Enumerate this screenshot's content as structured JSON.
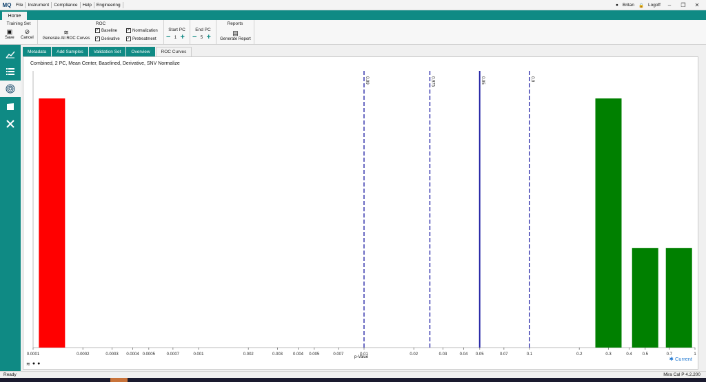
{
  "app": {
    "logo": "MQ",
    "menu": [
      "File",
      "Instrument",
      "Compliance",
      "Help",
      "Engineering"
    ],
    "user": "Britan",
    "logoff": "Logoff"
  },
  "home_tab": "Home",
  "ribbon": {
    "training_set": {
      "title": "Training Set",
      "save": "Save",
      "cancel": "Cancel"
    },
    "roc": {
      "title": "ROC",
      "generate_all": "Generate All ROC Curves",
      "baseline": "Baseline",
      "derivative": "Derivative",
      "normalization": "Normalization",
      "pretreatment": "Pretreatment"
    },
    "start_pc": {
      "label": "Start PC",
      "value": "1"
    },
    "end_pc": {
      "label": "End PC",
      "value": "5"
    },
    "reports": {
      "title": "Reports",
      "generate_report": "Generate Report"
    }
  },
  "sidebar": [
    "chart-line-icon",
    "list-icon",
    "fingerprint-icon",
    "book-icon",
    "tools-icon"
  ],
  "subtabs": [
    "Metadata",
    "Add Samples",
    "Validation Set",
    "Overview",
    "ROC Curves"
  ],
  "chart_data": {
    "type": "bar",
    "title": "Combined, 2 PC, Mean Center, Baselined, Derivative, SNV Normalize",
    "xlabel": "p-Value",
    "xscale": "log",
    "xlim": [
      0.0001,
      1
    ],
    "tick_labels": [
      "0.0001",
      "0.0002",
      "0.0003",
      "0.0004",
      "0.0005",
      "0.0007",
      "0.001",
      "0.002",
      "0.003",
      "0.004",
      "0.005",
      "0.007",
      "0.01",
      "0.02",
      "0.03",
      "0.04",
      "0.05",
      "0.07",
      "0.1",
      "0.2",
      "0.3",
      "0.4",
      "0.5",
      "0.7",
      "1"
    ],
    "tick_values": [
      0.0001,
      0.0002,
      0.0003,
      0.0004,
      0.0005,
      0.0007,
      0.001,
      0.002,
      0.003,
      0.004,
      0.005,
      0.007,
      0.01,
      0.02,
      0.03,
      0.04,
      0.05,
      0.07,
      0.1,
      0.2,
      0.3,
      0.4,
      0.5,
      0.7,
      1
    ],
    "bars": [
      {
        "x": 0.00013,
        "value": 1.0,
        "color": "#ff0000"
      },
      {
        "x": 0.3,
        "value": 1.0,
        "color": "#008000"
      },
      {
        "x": 0.5,
        "value": 0.4,
        "color": "#008000"
      },
      {
        "x": 0.8,
        "value": 0.4,
        "color": "#008000"
      }
    ],
    "reference_lines": [
      {
        "x": 0.01,
        "label": "0.99",
        "style": "dashed"
      },
      {
        "x": 0.025,
        "label": "0.975",
        "style": "dashed"
      },
      {
        "x": 0.05,
        "label": "0.95",
        "style": "solid"
      },
      {
        "x": 0.1,
        "label": "0.9",
        "style": "dashed"
      }
    ],
    "legend": "Current"
  },
  "status": {
    "left": "Ready",
    "right": "Mira Cal P 4.2.200"
  }
}
